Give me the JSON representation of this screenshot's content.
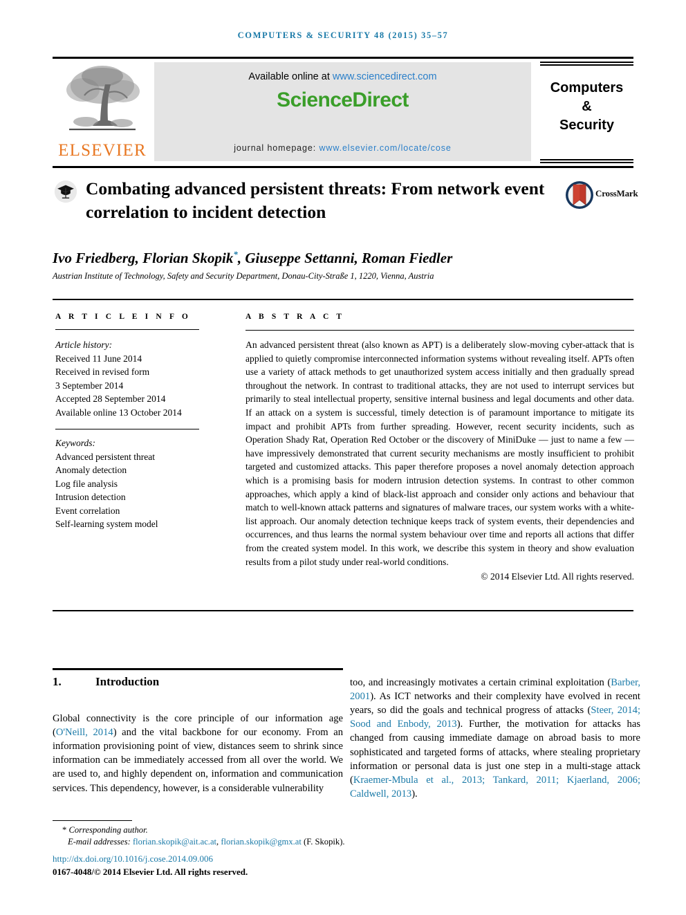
{
  "running_head": "COMPUTERS & SECURITY 48 (2015) 35–57",
  "masthead": {
    "publisher_name": "ELSEVIER",
    "available_online_prefix": "Available online at ",
    "sciencedirect_url": "www.sciencedirect.com",
    "sciencedirect_logo": "ScienceDirect",
    "homepage_prefix": "journal homepage: ",
    "homepage_url": "www.elsevier.com/locate/cose",
    "journal_title_line1": "Computers",
    "journal_title_line2": "&",
    "journal_title_line3": "Security"
  },
  "article": {
    "title": "Combating advanced persistent threats: From network event correlation to incident detection",
    "crossmark_label": "CrossMark",
    "authors": "Ivo Friedberg, Florian Skopik",
    "authors_corresponding_marker": "*",
    "authors_rest": ", Giuseppe Settanni, Roman Fiedler",
    "affiliation": "Austrian Institute of Technology, Safety and Security Department, Donau-City-Straße 1, 1220, Vienna, Austria"
  },
  "article_info": {
    "heading": "A R T I C L E  I N F O",
    "history_label": "Article history:",
    "history": [
      "Received 11 June 2014",
      "Received in revised form",
      "3 September 2014",
      "Accepted 28 September 2014",
      "Available online 13 October 2014"
    ],
    "keywords_label": "Keywords:",
    "keywords": [
      "Advanced persistent threat",
      "Anomaly detection",
      "Log file analysis",
      "Intrusion detection",
      "Event correlation",
      "Self-learning system model"
    ]
  },
  "abstract": {
    "heading": "A B S T R A C T",
    "text": "An advanced persistent threat (also known as APT) is a deliberately slow-moving cyber-attack that is applied to quietly compromise interconnected information systems without revealing itself. APTs often use a variety of attack methods to get unauthorized system access initially and then gradually spread throughout the network. In contrast to traditional attacks, they are not used to interrupt services but primarily to steal intellectual property, sensitive internal business and legal documents and other data. If an attack on a system is successful, timely detection is of paramount importance to mitigate its impact and prohibit APTs from further spreading. However, recent security incidents, such as Operation Shady Rat, Operation Red October or the discovery of MiniDuke — just to name a few — have impressively demonstrated that current security mechanisms are mostly insufficient to prohibit targeted and customized attacks. This paper therefore proposes a novel anomaly detection approach which is a promising basis for modern intrusion detection systems. In contrast to other common approaches, which apply a kind of black-list approach and consider only actions and behaviour that match to well-known attack patterns and signatures of malware traces, our system works with a white-list approach. Our anomaly detection technique keeps track of system events, their dependencies and occurrences, and thus learns the normal system behaviour over time and reports all actions that differ from the created system model. In this work, we describe this system in theory and show evaluation results from a pilot study under real-world conditions.",
    "rights": "© 2014 Elsevier Ltd. All rights reserved."
  },
  "introduction": {
    "section_number": "1.",
    "section_title": "Introduction",
    "left_par_1": "Global connectivity is the core principle of our information age (",
    "left_cite_1": "O'Neill, 2014",
    "left_par_2": ") and the vital backbone for our economy. From an information provisioning point of view, distances seem to shrink since information can be immediately accessed from all over the world. We are used to, and highly dependent on, information and communication services. This dependency, however, is a considerable vulnerability",
    "right_par_1": "too, and increasingly motivates a certain criminal exploitation (",
    "right_cite_1": "Barber, 2001",
    "right_par_2": "). As ICT networks and their complexity have evolved in recent years, so did the goals and technical progress of attacks (",
    "right_cite_2": "Steer, 2014; Sood and Enbody, 2013",
    "right_par_3": "). Further, the motivation for attacks has changed from causing immediate damage on abroad basis to more sophisticated and targeted forms of attacks, where stealing proprietary information or personal data is just one step in a multi-stage attack (",
    "right_cite_3": "Kraemer-Mbula et al., 2013; Tankard, 2011; Kjaerland, 2006; Caldwell, 2013",
    "right_par_4": ")."
  },
  "footer": {
    "corresponding_marker": "*",
    "corresponding_label": "Corresponding author.",
    "email_label": "E-mail addresses:",
    "email_1": "florian.skopik@ait.ac.at",
    "email_sep": ", ",
    "email_2": "florian.skopik@gmx.at",
    "email_suffix": " (F. Skopik).",
    "doi": "http://dx.doi.org/10.1016/j.cose.2014.09.006",
    "issn_line": "0167-4048/© 2014 Elsevier Ltd. All rights reserved."
  },
  "colors": {
    "link_blue": "#1a7aa8",
    "sd_link_blue": "#2a7fc9",
    "elsevier_orange": "#E87722",
    "sciencedirect_green": "#3a9e29",
    "banner_gray": "#e4e4e4"
  }
}
